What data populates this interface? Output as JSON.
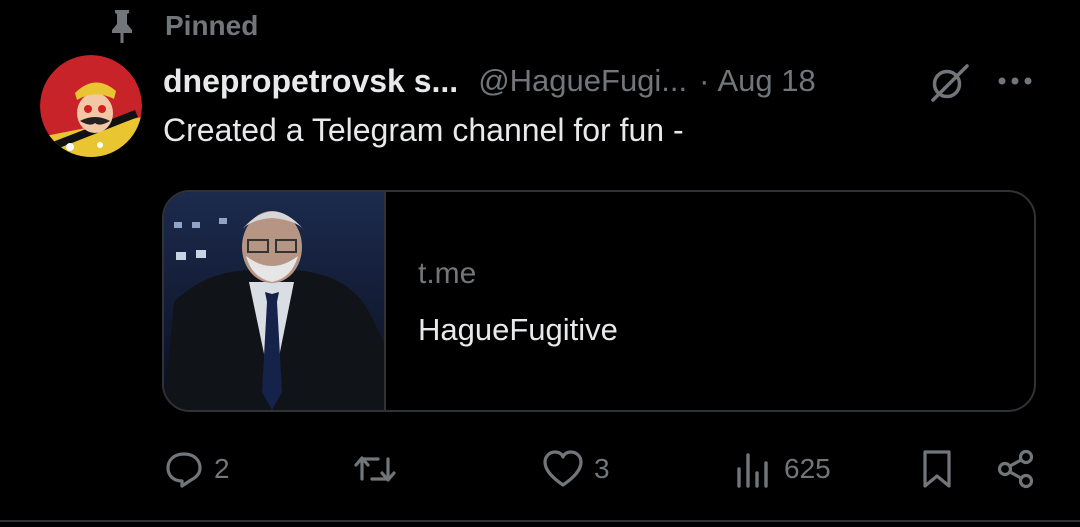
{
  "pinned": {
    "label": "Pinned",
    "icon": "pin-icon"
  },
  "author": {
    "display_name": "dnepropetrovsk s...",
    "handle": "@HagueFugi...",
    "timestamp": "Aug 18",
    "separator": "·",
    "avatar": "avatar"
  },
  "tweet": {
    "text": "Created a Telegram channel for fun -"
  },
  "link_card": {
    "domain": "t.me",
    "title": "HagueFugitive"
  },
  "actions": {
    "replies": "2",
    "reposts": "",
    "likes": "3",
    "views": "625"
  },
  "icons": [
    "pin-icon",
    "grok-icon",
    "more-icon",
    "reply-icon",
    "repost-icon",
    "like-icon",
    "views-icon",
    "bookmark-icon",
    "share-icon"
  ],
  "colors": {
    "background": "#000000",
    "text": "#e7e9ea",
    "muted": "#71767b",
    "border": "#2f3336"
  }
}
